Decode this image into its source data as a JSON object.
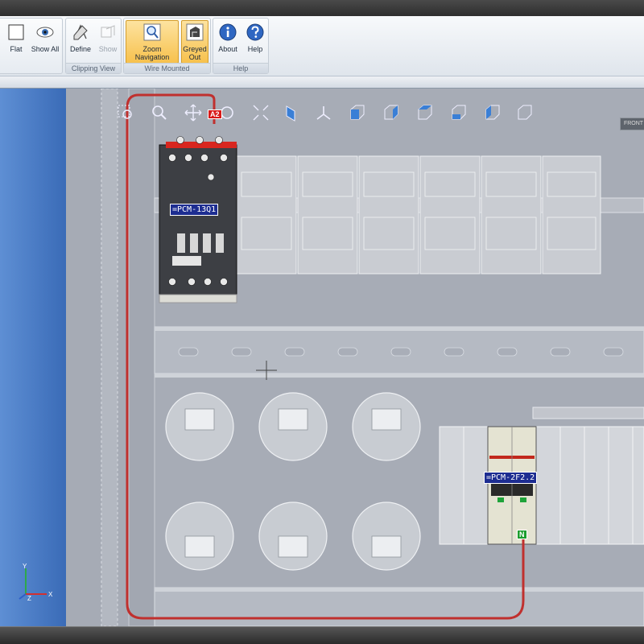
{
  "ribbon": {
    "buttons": {
      "flat": "Flat",
      "show_all": "Show All",
      "define": "Define",
      "show": "Show",
      "zoom_navigation": "Zoom Navigation",
      "greyed_out_line1": "Greyed",
      "greyed_out_line2": "Out",
      "about": "About",
      "help": "Help"
    },
    "groups": {
      "clipping_view": "Clipping View",
      "wire_mounted": "Wire Mounted",
      "help": "Help"
    }
  },
  "viewport": {
    "device_labels": {
      "contactor": "=PCM-13Q1",
      "breaker": "=PCM-2F2.2"
    },
    "pin_labels": {
      "a2": "A2",
      "n": "N"
    },
    "front_badge": "FRONT"
  },
  "axis": {
    "y": "Y",
    "x": "X",
    "z": "Z"
  },
  "colors": {
    "wire": "#c0302e",
    "label_bg": "#1d2d91",
    "active_button": "#f7c14d",
    "viewport_bg": "#a6abb5",
    "left_panel": "#3a6bb7"
  },
  "icons": [
    "flat-icon",
    "show-all-icon",
    "define-icon",
    "show-icon",
    "zoom-navigation-icon",
    "greyed-out-icon",
    "about-icon",
    "help-icon"
  ]
}
